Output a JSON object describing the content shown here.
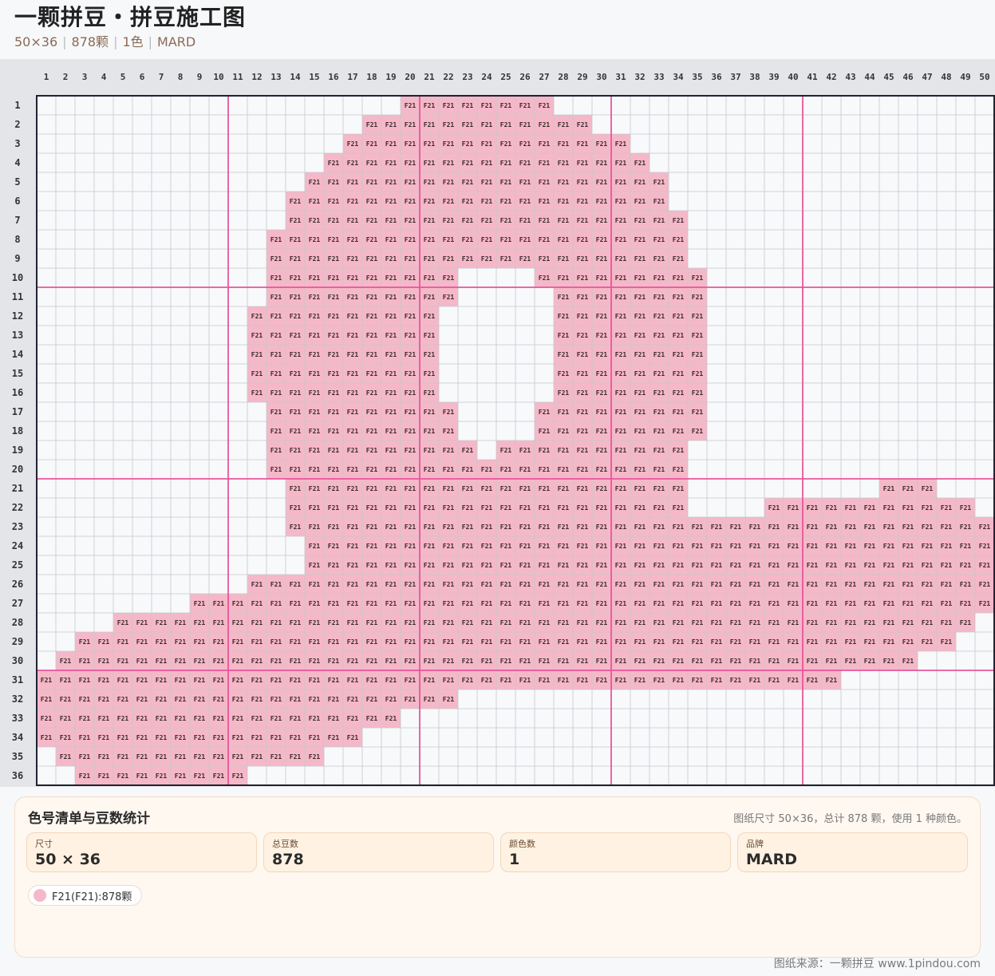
{
  "header": {
    "title": "一颗拼豆・拼豆施工图",
    "size": "50×36",
    "count": "878颗",
    "colors": "1色",
    "brand": "MARD"
  },
  "grid": {
    "cols": 50,
    "rows": 36,
    "bead_code": "F21",
    "bead_color": "#f5b8c8",
    "guide_color": "#e8559a",
    "filled_runs": [
      [
        [
          20,
          27
        ]
      ],
      [
        [
          18,
          29
        ]
      ],
      [
        [
          17,
          31
        ]
      ],
      [
        [
          16,
          32
        ]
      ],
      [
        [
          15,
          33
        ]
      ],
      [
        [
          14,
          33
        ]
      ],
      [
        [
          14,
          34
        ]
      ],
      [
        [
          13,
          34
        ]
      ],
      [
        [
          13,
          34
        ]
      ],
      [
        [
          13,
          22
        ],
        [
          27,
          35
        ]
      ],
      [
        [
          13,
          22
        ],
        [
          28,
          35
        ]
      ],
      [
        [
          12,
          21
        ],
        [
          28,
          35
        ]
      ],
      [
        [
          12,
          21
        ],
        [
          28,
          35
        ]
      ],
      [
        [
          12,
          21
        ],
        [
          28,
          35
        ]
      ],
      [
        [
          12,
          21
        ],
        [
          28,
          35
        ]
      ],
      [
        [
          12,
          21
        ],
        [
          28,
          35
        ]
      ],
      [
        [
          13,
          22
        ],
        [
          27,
          35
        ]
      ],
      [
        [
          13,
          22
        ],
        [
          27,
          35
        ]
      ],
      [
        [
          13,
          23
        ],
        [
          25,
          34
        ]
      ],
      [
        [
          13,
          34
        ]
      ],
      [
        [
          14,
          34
        ],
        [
          45,
          47
        ]
      ],
      [
        [
          14,
          34
        ],
        [
          39,
          49
        ]
      ],
      [
        [
          14,
          50
        ]
      ],
      [
        [
          15,
          50
        ]
      ],
      [
        [
          15,
          50
        ]
      ],
      [
        [
          12,
          50
        ]
      ],
      [
        [
          9,
          50
        ]
      ],
      [
        [
          5,
          49
        ]
      ],
      [
        [
          3,
          48
        ]
      ],
      [
        [
          2,
          46
        ]
      ],
      [
        [
          1,
          42
        ]
      ],
      [
        [
          1,
          22
        ]
      ],
      [
        [
          1,
          19
        ]
      ],
      [
        [
          1,
          17
        ]
      ],
      [
        [
          2,
          15
        ]
      ],
      [
        [
          3,
          11
        ]
      ]
    ]
  },
  "panel": {
    "title": "色号清单与豆数统计",
    "summary": "图纸尺寸 50×36，总计 878 颗，使用 1 种颜色。",
    "stats": [
      {
        "label": "尺寸",
        "value": "50 × 36"
      },
      {
        "label": "总豆数",
        "value": "878"
      },
      {
        "label": "颜色数",
        "value": "1"
      },
      {
        "label": "品牌",
        "value": "MARD"
      }
    ],
    "legend": [
      {
        "label": "F21(F21):878颗",
        "color": "#f5b8c8"
      }
    ]
  },
  "footer": {
    "source": "图纸来源：一颗拼豆 www.1pindou.com"
  }
}
